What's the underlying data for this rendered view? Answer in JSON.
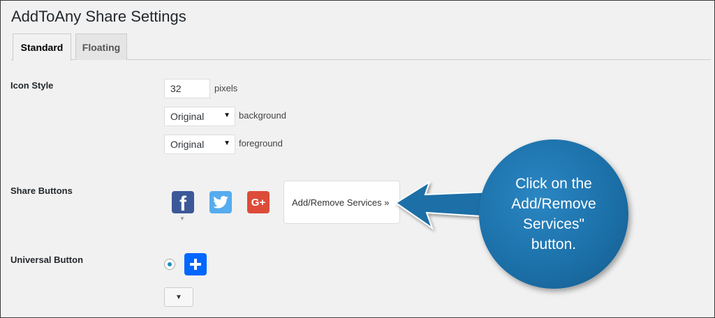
{
  "page": {
    "title": "AddToAny Share Settings"
  },
  "tabs": [
    {
      "label": "Standard",
      "active": true
    },
    {
      "label": "Floating",
      "active": false
    }
  ],
  "icon_style": {
    "label": "Icon Style",
    "size_value": "32",
    "size_unit": "pixels",
    "background_select": "Original",
    "background_label": "background",
    "foreground_select": "Original",
    "foreground_label": "foreground"
  },
  "share_buttons": {
    "label": "Share Buttons",
    "services": [
      {
        "name": "facebook-icon",
        "glyph": "f",
        "color": "#3b5998"
      },
      {
        "name": "twitter-icon",
        "color": "#55acee"
      },
      {
        "name": "google-plus-icon",
        "glyph": "G+",
        "color": "#dd4b39"
      }
    ],
    "add_remove_label": "Add/Remove Services »"
  },
  "universal_button": {
    "label": "Universal Button",
    "color": "#0166ff"
  },
  "callout": {
    "text": "Click on the Add/Remove Services\" button.",
    "color": "#1b6fa7"
  }
}
